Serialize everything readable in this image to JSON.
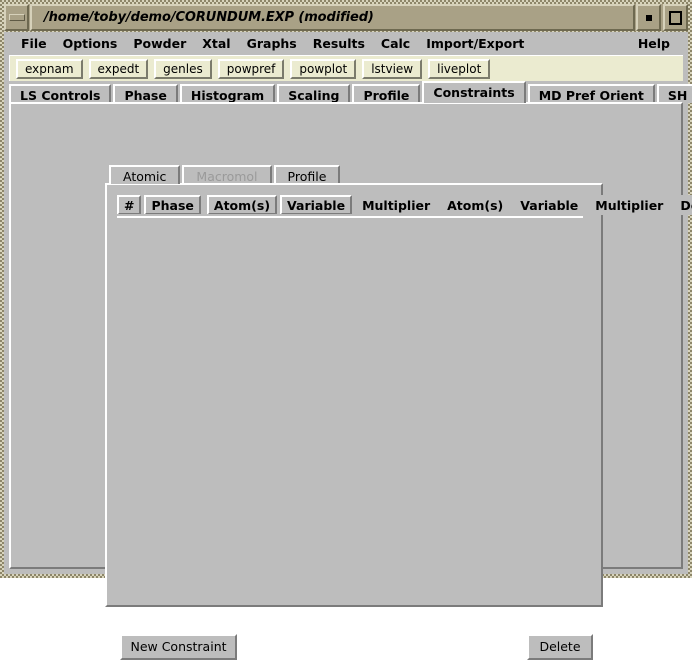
{
  "window": {
    "title": "/home/toby/demo/CORUNDUM.EXP (modified)",
    "menu_button_icon": "window-menu-icon",
    "minimize_icon": "minimize-icon",
    "maximize_icon": "maximize-icon",
    "colors": {
      "titlebar": "#a9a186",
      "panel": "#bdbdbd",
      "toolbar": "#ebebd0",
      "border_light": "#ffffff",
      "border_dark": "#7b7b7b",
      "disabled_text": "#9a9a9a"
    }
  },
  "menubar": {
    "left_items": [
      {
        "label": "File"
      },
      {
        "label": "Options"
      },
      {
        "label": "Powder"
      },
      {
        "label": "Xtal"
      },
      {
        "label": "Graphs"
      },
      {
        "label": "Results"
      },
      {
        "label": "Calc"
      },
      {
        "label": "Import/Export"
      }
    ],
    "right_items": [
      {
        "label": "Help"
      }
    ]
  },
  "toolbar": {
    "buttons": [
      {
        "label": "expnam"
      },
      {
        "label": "expedt"
      },
      {
        "label": "genles"
      },
      {
        "label": "powpref"
      },
      {
        "label": "powplot"
      },
      {
        "label": "lstview"
      },
      {
        "label": "liveplot"
      }
    ]
  },
  "notebook": {
    "tabs": [
      {
        "label": "LS Controls",
        "selected": false
      },
      {
        "label": "Phase",
        "selected": false
      },
      {
        "label": "Histogram",
        "selected": false
      },
      {
        "label": "Scaling",
        "selected": false
      },
      {
        "label": "Profile",
        "selected": false
      },
      {
        "label": "Constraints",
        "selected": true
      },
      {
        "label": "MD Pref Orient",
        "selected": false
      },
      {
        "label": "SH Pref Orient",
        "selected": false
      }
    ],
    "scroll_arrow_icon": "chevron-right-icon"
  },
  "inner_notebook": {
    "tabs": [
      {
        "label": "Atomic",
        "selected": true,
        "disabled": false
      },
      {
        "label": "Macromol",
        "selected": false,
        "disabled": true
      },
      {
        "label": "Profile",
        "selected": false,
        "disabled": false
      }
    ]
  },
  "constraint_table": {
    "columns": [
      {
        "label": "#",
        "style": "raised"
      },
      {
        "label": "Phase",
        "style": "raised"
      },
      {
        "label": "Atom(s)",
        "style": "raised"
      },
      {
        "label": "Variable",
        "style": "raised"
      },
      {
        "label": "Multiplier",
        "style": "flat"
      },
      {
        "label": "Atom(s)",
        "style": "flat"
      },
      {
        "label": "Variable",
        "style": "flat"
      },
      {
        "label": "Multiplier",
        "style": "flat"
      },
      {
        "label": "Delete",
        "style": "flat"
      }
    ],
    "rows": []
  },
  "actions": {
    "new_constraint_label": "New Constraint",
    "delete_label": "Delete"
  }
}
